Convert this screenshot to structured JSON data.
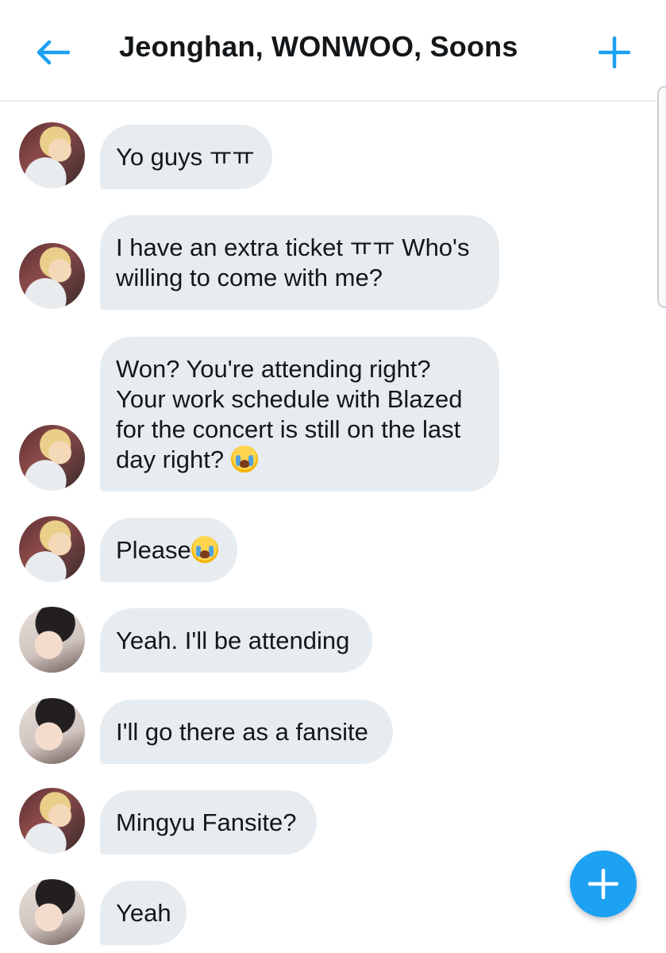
{
  "header": {
    "title": "Jeonghan, WONWOO, Soons",
    "back_icon": "arrow-left-icon",
    "add_icon": "plus-icon"
  },
  "colors": {
    "accent": "#1da1f2",
    "bubble": "#e6ecf0",
    "text": "#14171a"
  },
  "messages": [
    {
      "sender": "jeonghan",
      "text": "Yo guys ㅠㅠ"
    },
    {
      "sender": "jeonghan",
      "text": "I have an extra ticket ㅠㅠ Who's willing to come with me?"
    },
    {
      "sender": "jeonghan",
      "text": "Won? You're attending right? Your work schedule with Blazed for the concert is still on the last day right?",
      "emoji": "crying-face-emoji"
    },
    {
      "sender": "jeonghan",
      "text": "Please",
      "emoji": "crying-face-emoji"
    },
    {
      "sender": "wonwoo",
      "text": "Yeah. I'll be attending"
    },
    {
      "sender": "wonwoo",
      "text": "I'll go there as a fansite"
    },
    {
      "sender": "jeonghan",
      "text": "Mingyu Fansite?"
    },
    {
      "sender": "wonwoo",
      "text": "Yeah"
    }
  ],
  "fab": {
    "icon": "plus-icon"
  }
}
